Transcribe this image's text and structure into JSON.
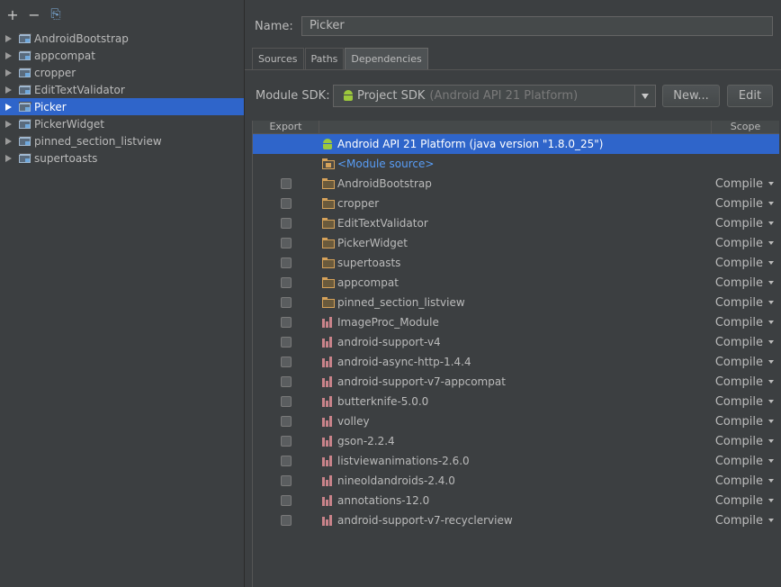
{
  "toolbar": {
    "add": "+",
    "remove": "−",
    "copy": "⎘"
  },
  "modules": [
    {
      "label": "AndroidBootstrap",
      "selected": false
    },
    {
      "label": "appcompat",
      "selected": false
    },
    {
      "label": "cropper",
      "selected": false
    },
    {
      "label": "EditTextValidator",
      "selected": false
    },
    {
      "label": "Picker",
      "selected": true
    },
    {
      "label": "PickerWidget",
      "selected": false
    },
    {
      "label": "pinned_section_listview",
      "selected": false
    },
    {
      "label": "supertoasts",
      "selected": false
    }
  ],
  "name": {
    "label": "Name:",
    "value": "Picker"
  },
  "tabs": [
    {
      "label": "Sources",
      "active": false
    },
    {
      "label": "Paths",
      "active": false
    },
    {
      "label": "Dependencies",
      "active": true
    }
  ],
  "sdk": {
    "label": "Module SDK:",
    "selected_main": "Project SDK",
    "selected_sub": "(Android API 21 Platform)",
    "new_button": "New...",
    "edit_button": "Edit"
  },
  "table": {
    "col_export": "Export",
    "col_scope": "Scope",
    "sdk_row": "Android API 21 Platform (java version \"1.8.0_25\")",
    "module_source": "<Module source>",
    "rows": [
      {
        "label": "AndroidBootstrap",
        "icon": "folder-icon",
        "scope": "Compile"
      },
      {
        "label": "cropper",
        "icon": "folder-icon",
        "scope": "Compile"
      },
      {
        "label": "EditTextValidator",
        "icon": "folder-icon",
        "scope": "Compile"
      },
      {
        "label": "PickerWidget",
        "icon": "folder-icon",
        "scope": "Compile"
      },
      {
        "label": "supertoasts",
        "icon": "folder-icon",
        "scope": "Compile"
      },
      {
        "label": "appcompat",
        "icon": "folder-icon",
        "scope": "Compile"
      },
      {
        "label": "pinned_section_listview",
        "icon": "folder-icon",
        "scope": "Compile"
      },
      {
        "label": "ImageProc_Module",
        "icon": "library-icon",
        "scope": "Compile"
      },
      {
        "label": "android-support-v4",
        "icon": "library-icon",
        "scope": "Compile"
      },
      {
        "label": "android-async-http-1.4.4",
        "icon": "library-icon",
        "scope": "Compile"
      },
      {
        "label": "android-support-v7-appcompat",
        "icon": "library-icon",
        "scope": "Compile"
      },
      {
        "label": "butterknife-5.0.0",
        "icon": "library-icon",
        "scope": "Compile"
      },
      {
        "label": "volley",
        "icon": "library-icon",
        "scope": "Compile"
      },
      {
        "label": "gson-2.2.4",
        "icon": "library-icon",
        "scope": "Compile"
      },
      {
        "label": "listviewanimations-2.6.0",
        "icon": "library-icon",
        "scope": "Compile"
      },
      {
        "label": "nineoldandroids-2.4.0",
        "icon": "library-icon",
        "scope": "Compile"
      },
      {
        "label": "annotations-12.0",
        "icon": "library-icon",
        "scope": "Compile"
      },
      {
        "label": "android-support-v7-recyclerview",
        "icon": "library-icon",
        "scope": "Compile"
      }
    ]
  }
}
